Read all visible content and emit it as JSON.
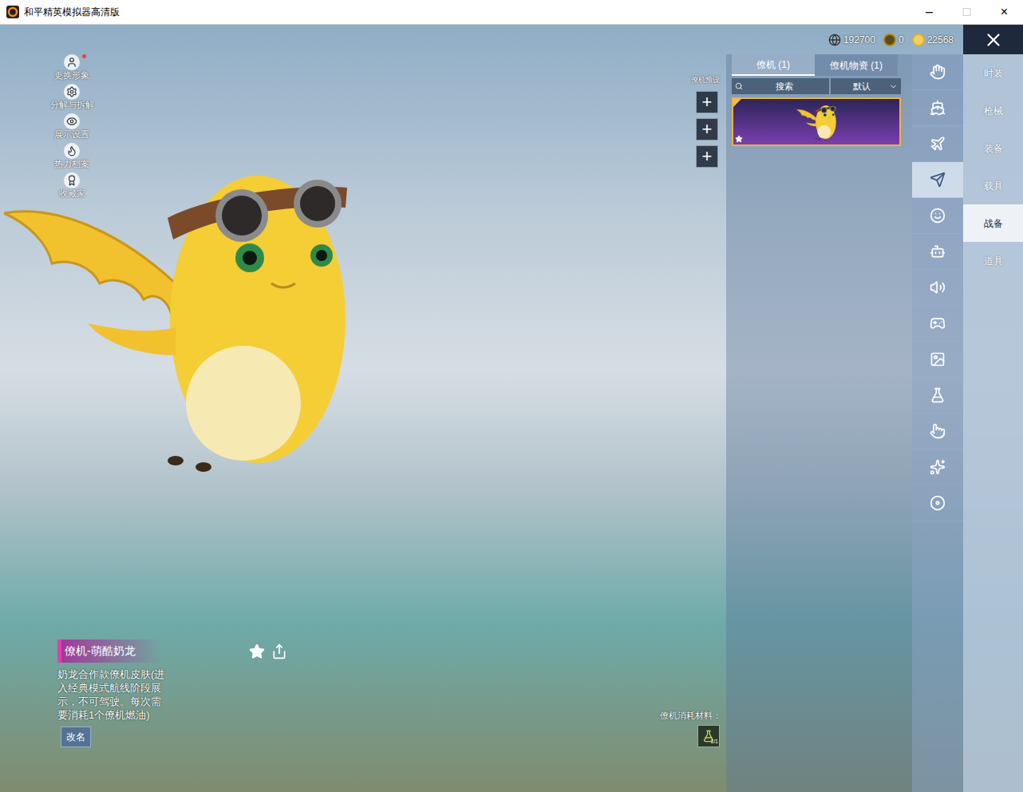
{
  "window": {
    "title": "和平精英模拟器高清版",
    "controls": [
      "–",
      "□",
      "×"
    ]
  },
  "currency": [
    {
      "value": "192700"
    },
    {
      "value": "0"
    },
    {
      "value": "22568"
    }
  ],
  "side_actions": [
    {
      "label": "更换形象",
      "badge": true
    },
    {
      "label": "分解与拆解",
      "badge": false
    },
    {
      "label": "展示设置",
      "badge": false
    },
    {
      "label": "热力档案",
      "badge": false
    },
    {
      "label": "收藏家",
      "badge": false
    }
  ],
  "preset": {
    "label": "僚机预设",
    "slots": [
      "+",
      "+",
      "+"
    ]
  },
  "panel": {
    "tabs": [
      {
        "label": "僚机 (1)",
        "selected": true
      },
      {
        "label": "僚机物资 (1)",
        "selected": false
      }
    ],
    "search": {
      "placeholder": "搜索"
    },
    "sort": "默认",
    "items": [
      {
        "selected": true,
        "equipped": true,
        "favorite": true
      }
    ]
  },
  "icon_bar": [
    {
      "selected": false
    },
    {
      "selected": false
    },
    {
      "selected": false
    },
    {
      "selected": true
    },
    {
      "selected": false
    },
    {
      "selected": false
    },
    {
      "selected": false
    },
    {
      "selected": false
    },
    {
      "selected": false
    },
    {
      "selected": false
    },
    {
      "selected": false
    },
    {
      "selected": false
    },
    {
      "selected": false
    }
  ],
  "categories": [
    {
      "label": "时装",
      "selected": false
    },
    {
      "label": "枪械",
      "selected": false
    },
    {
      "label": "装备",
      "selected": false
    },
    {
      "label": "载具",
      "selected": false
    },
    {
      "label": "战备",
      "selected": true
    },
    {
      "label": "道具",
      "selected": false
    }
  ],
  "item_info": {
    "title": "僚机-萌酷奶龙",
    "description": "奶龙合作款僚机皮肤(进入经典模式航线阶段展示，不可驾驶。每次需要消耗1个僚机燃油)",
    "rename": "改名"
  },
  "materials": {
    "label": "僚机消耗材料：",
    "count": "1/1"
  }
}
